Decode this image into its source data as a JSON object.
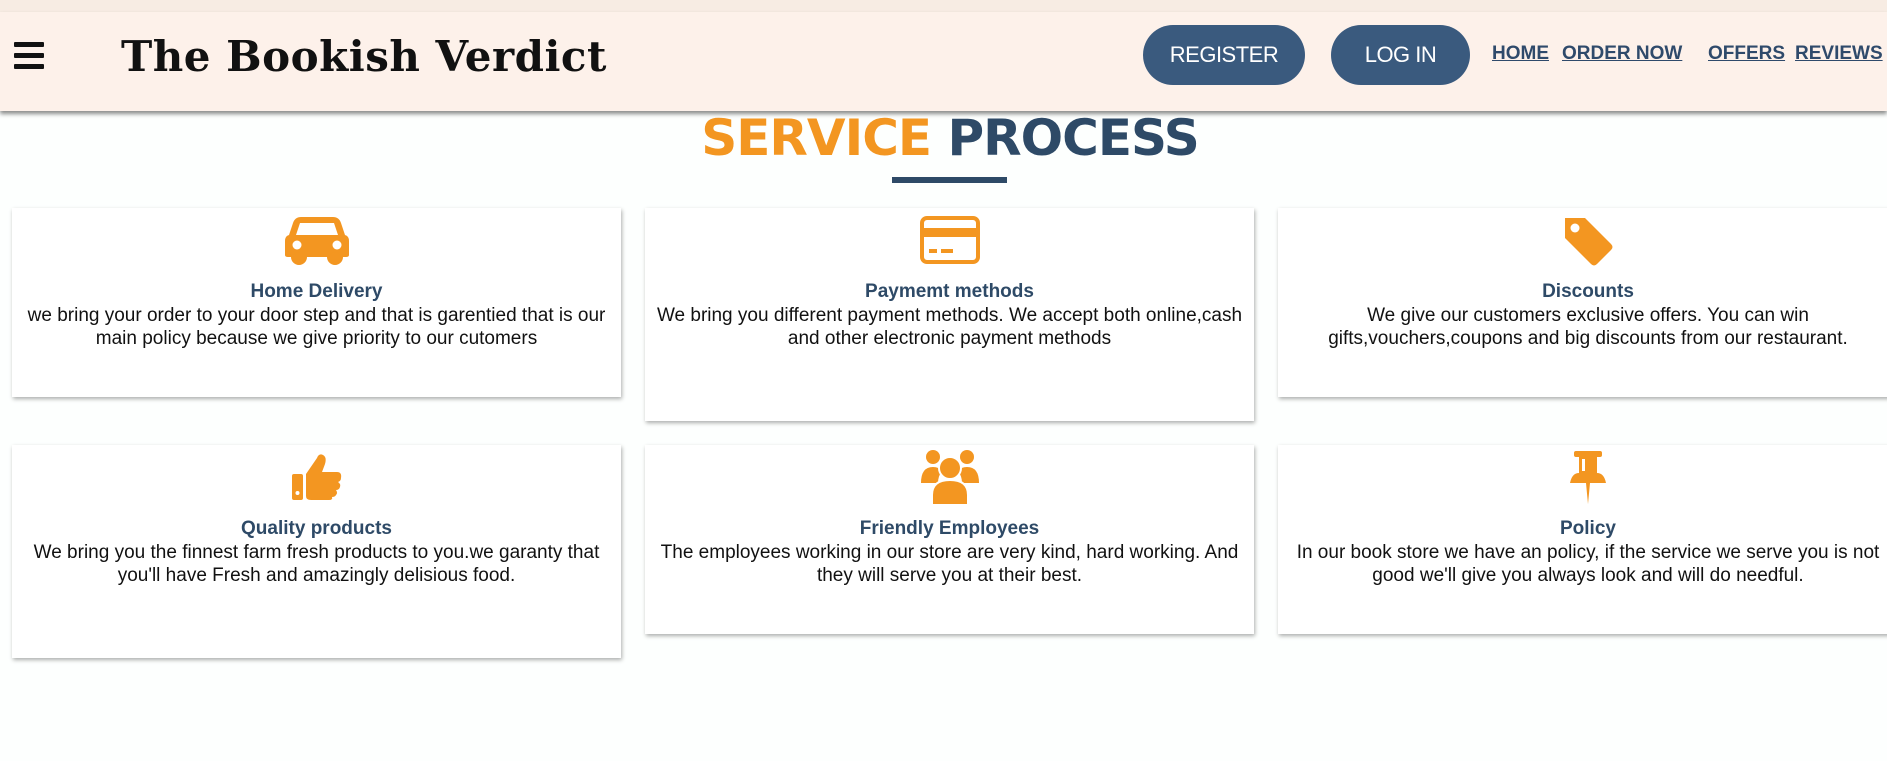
{
  "brand": {
    "title": "The Bookish Verdict"
  },
  "nav": {
    "menu_icon": "hamburger-menu-icon",
    "register": "REGISTER",
    "login": "LOG IN",
    "links": [
      "HOME",
      "ORDER NOW",
      "OFFERS",
      "REVIEWS"
    ]
  },
  "section": {
    "title_part1": "SERVICE",
    "title_part2": "PROCESS"
  },
  "cards": [
    {
      "icon": "car-icon",
      "title": "Home Delivery",
      "desc": "we bring your order to your door step and that is garentied that is our main policy because we give priority to our cutomers"
    },
    {
      "icon": "credit-card-icon",
      "title": "Paymemt methods",
      "desc": "We bring you different payment methods. We accept both online,cash and other electronic payment methods"
    },
    {
      "icon": "tag-icon",
      "title": "Discounts",
      "desc": "We give our customers exclusive offers. You can win gifts,vouchers,coupons and big discounts from our restaurant."
    },
    {
      "icon": "thumbs-up-icon",
      "title": "Quality products",
      "desc": "We bring you the finnest farm fresh products to you.we garanty that you'll have Fresh and amazingly delisious food."
    },
    {
      "icon": "users-icon",
      "title": "Friendly Employees",
      "desc": "The employees working in our store are very kind, hard working. And they will serve you at their best."
    },
    {
      "icon": "pushpin-icon",
      "title": "Policy",
      "desc": "In our book store we have an policy, if the service we serve you is not good we'll give you always look and will do needful."
    }
  ],
  "colors": {
    "accent": "#f39621",
    "primary": "#2e4a67",
    "button": "#3a5a7e",
    "navbar_bg": "#fdf1ea"
  }
}
